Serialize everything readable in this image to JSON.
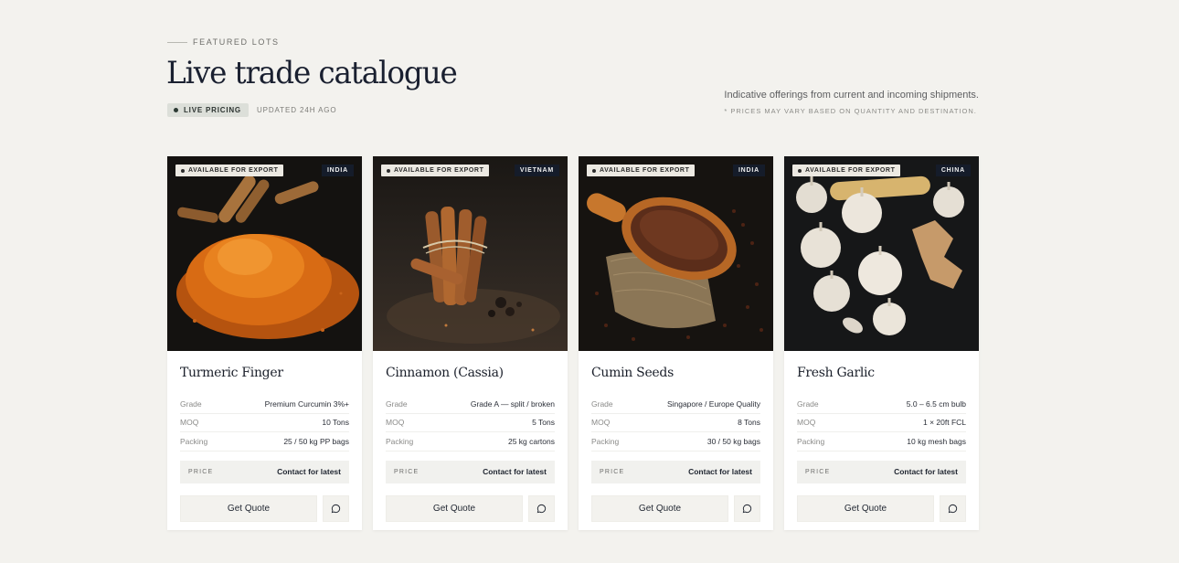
{
  "header": {
    "eyebrow": "FEATURED LOTS",
    "title": "Live trade catalogue",
    "live_badge": "LIVE PRICING",
    "updated": "UPDATED 24H AGO",
    "note_main": "Indicative offerings from current and incoming shipments.",
    "note_sub": "* PRICES MAY VARY BASED ON QUANTITY AND DESTINATION."
  },
  "cards": [
    {
      "availability": "AVAILABLE FOR EXPORT",
      "origin": "INDIA",
      "name": "Turmeric Finger",
      "specs": [
        {
          "label": "Grade",
          "value": "Premium Curcumin 3%+"
        },
        {
          "label": "MOQ",
          "value": "10 Tons"
        },
        {
          "label": "Packing",
          "value": "25 / 50 kg PP bags"
        }
      ],
      "price_label": "PRICE",
      "price_value": "Contact for latest",
      "quote_label": "Get Quote",
      "image_icon": "turmeric-image"
    },
    {
      "availability": "AVAILABLE FOR EXPORT",
      "origin": "VIETNAM",
      "name": "Cinnamon (Cassia)",
      "specs": [
        {
          "label": "Grade",
          "value": "Grade A — split / broken"
        },
        {
          "label": "MOQ",
          "value": "5 Tons"
        },
        {
          "label": "Packing",
          "value": "25 kg cartons"
        }
      ],
      "price_label": "PRICE",
      "price_value": "Contact for latest",
      "quote_label": "Get Quote",
      "image_icon": "cinnamon-image"
    },
    {
      "availability": "AVAILABLE FOR EXPORT",
      "origin": "INDIA",
      "name": "Cumin Seeds",
      "specs": [
        {
          "label": "Grade",
          "value": "Singapore / Europe Quality"
        },
        {
          "label": "MOQ",
          "value": "8 Tons"
        },
        {
          "label": "Packing",
          "value": "30 / 50 kg bags"
        }
      ],
      "price_label": "PRICE",
      "price_value": "Contact for latest",
      "quote_label": "Get Quote",
      "image_icon": "cumin-image"
    },
    {
      "availability": "AVAILABLE FOR EXPORT",
      "origin": "CHINA",
      "name": "Fresh Garlic",
      "specs": [
        {
          "label": "Grade",
          "value": "5.0 – 6.5 cm bulb"
        },
        {
          "label": "MOQ",
          "value": "1 × 20ft FCL"
        },
        {
          "label": "Packing",
          "value": "10 kg mesh bags"
        }
      ],
      "price_label": "PRICE",
      "price_value": "Contact for latest",
      "quote_label": "Get Quote",
      "image_icon": "garlic-image"
    }
  ],
  "colors": {
    "background": "#f3f2ee",
    "origin_tag": "#151c2a",
    "live_badge": "#dcdfd9"
  }
}
